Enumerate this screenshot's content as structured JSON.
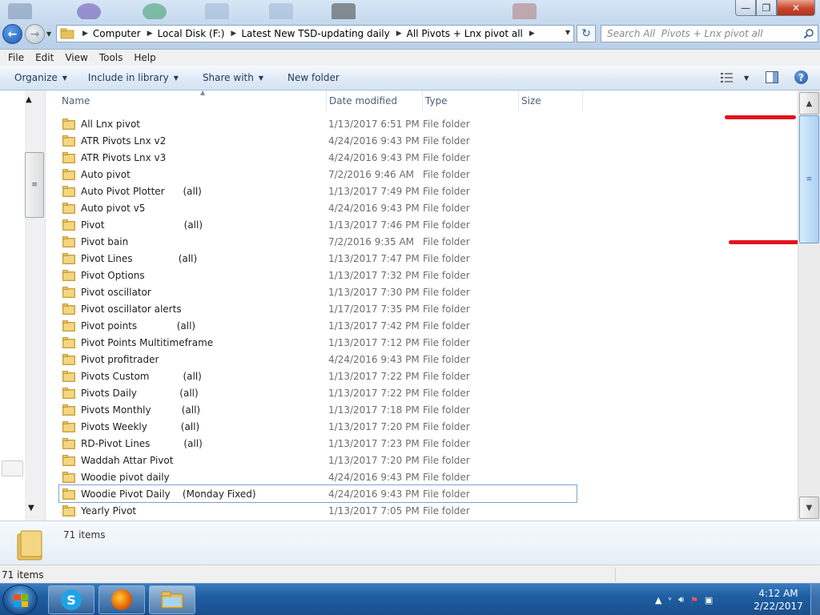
{
  "window": {
    "minimize_label": "—",
    "maximize_label": "❐",
    "close_label": "✕"
  },
  "address": {
    "crumbs": [
      "Computer",
      "Local Disk (F:)",
      "Latest New TSD-updating daily",
      "All  Pivots + Lnx pivot all"
    ]
  },
  "search": {
    "placeholder": "Search All  Pivots + Lnx pivot all"
  },
  "menu": {
    "items": [
      "File",
      "Edit",
      "View",
      "Tools",
      "Help"
    ]
  },
  "commands": {
    "organize": "Organize",
    "include": "Include in library",
    "share": "Share with",
    "new_folder": "New folder"
  },
  "columns": {
    "name": "Name",
    "date": "Date modified",
    "type": "Type",
    "size": "Size"
  },
  "files": [
    {
      "name": "All Lnx pivot",
      "date": "1/13/2017 6:51 PM",
      "type": "File folder"
    },
    {
      "name": "ATR Pivots Lnx v2",
      "date": "4/24/2016 9:43 PM",
      "type": "File folder"
    },
    {
      "name": "ATR Pivots Lnx v3",
      "date": "4/24/2016 9:43 PM",
      "type": "File folder"
    },
    {
      "name": "Auto pivot",
      "date": "7/2/2016 9:46 AM",
      "type": "File folder"
    },
    {
      "name": "Auto Pivot Plotter      (all)",
      "date": "1/13/2017 7:49 PM",
      "type": "File folder"
    },
    {
      "name": "Auto pivot v5",
      "date": "4/24/2016 9:43 PM",
      "type": "File folder"
    },
    {
      "name": "Pivot                          (all)",
      "date": "1/13/2017 7:46 PM",
      "type": "File folder"
    },
    {
      "name": "Pivot bain",
      "date": "7/2/2016 9:35 AM",
      "type": "File folder"
    },
    {
      "name": "Pivot Lines               (all)",
      "date": "1/13/2017 7:47 PM",
      "type": "File folder"
    },
    {
      "name": "Pivot Options",
      "date": "1/13/2017 7:32 PM",
      "type": "File folder"
    },
    {
      "name": "Pivot oscillator",
      "date": "1/13/2017 7:30 PM",
      "type": "File folder"
    },
    {
      "name": "Pivot oscillator alerts",
      "date": "1/17/2017 7:35 PM",
      "type": "File folder"
    },
    {
      "name": "Pivot points             (all)",
      "date": "1/13/2017 7:42 PM",
      "type": "File folder"
    },
    {
      "name": "Pivot Points Multitimeframe",
      "date": "1/13/2017 7:12 PM",
      "type": "File folder"
    },
    {
      "name": "Pivot profitrader",
      "date": "4/24/2016 9:43 PM",
      "type": "File folder"
    },
    {
      "name": "Pivots Custom           (all)",
      "date": "1/13/2017 7:22 PM",
      "type": "File folder"
    },
    {
      "name": "Pivots Daily              (all)",
      "date": "1/13/2017 7:22 PM",
      "type": "File folder"
    },
    {
      "name": "Pivots Monthly          (all)",
      "date": "1/13/2017 7:18 PM",
      "type": "File folder"
    },
    {
      "name": "Pivots Weekly           (all)",
      "date": "1/13/2017 7:20 PM",
      "type": "File folder"
    },
    {
      "name": "RD-Pivot Lines           (all)",
      "date": "1/13/2017 7:23 PM",
      "type": "File folder"
    },
    {
      "name": "Waddah Attar Pivot",
      "date": "1/13/2017 7:20 PM",
      "type": "File folder"
    },
    {
      "name": "Woodie pivot daily",
      "date": "4/24/2016 9:43 PM",
      "type": "File folder"
    },
    {
      "name": "Woodie Pivot Daily    (Monday Fixed)",
      "date": "4/24/2016 9:43 PM",
      "type": "File folder",
      "focused": true
    },
    {
      "name": "Yearly Pivot",
      "date": "1/13/2017 7:05 PM",
      "type": "File folder"
    }
  ],
  "details": {
    "count": "71 items"
  },
  "status": {
    "text": "71 items"
  },
  "taskbar": {
    "time": "4:12 AM",
    "date": "2/22/2017"
  },
  "colors": {
    "red_mark": "#e3131c",
    "taskbar": "#1e5fa3",
    "folder": "#e8c15a"
  }
}
